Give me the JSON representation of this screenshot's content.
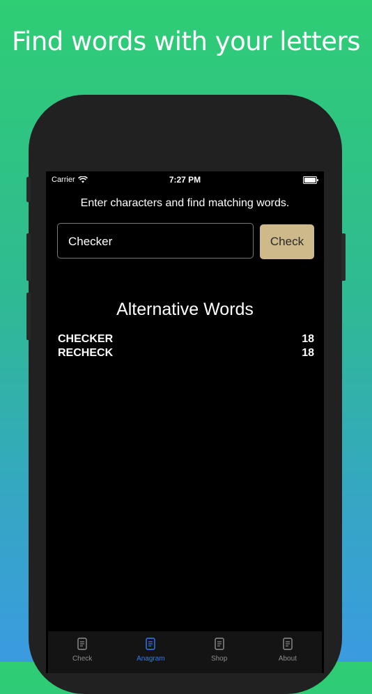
{
  "headline": "Find words with your letters",
  "status_bar": {
    "carrier": "Carrier",
    "time": "7:27 PM"
  },
  "instruction": "Enter characters and find matching words.",
  "input": {
    "value": "Checker"
  },
  "check_button": {
    "label": "Check"
  },
  "results": {
    "title": "Alternative Words",
    "words": [
      {
        "word": "CHECKER",
        "score": "18"
      },
      {
        "word": "RECHECK",
        "score": "18"
      }
    ]
  },
  "tabs": [
    {
      "label": "Check",
      "icon": "document-icon",
      "active": false
    },
    {
      "label": "Anagram",
      "icon": "document-icon",
      "active": true
    },
    {
      "label": "Shop",
      "icon": "document-icon",
      "active": false
    },
    {
      "label": "About",
      "icon": "document-icon",
      "active": false
    }
  ],
  "colors": {
    "accent": "#2f7cf6",
    "button": "#cdb98a",
    "gradient_top": "#2fcd74",
    "gradient_bottom": "#3a9be0"
  }
}
